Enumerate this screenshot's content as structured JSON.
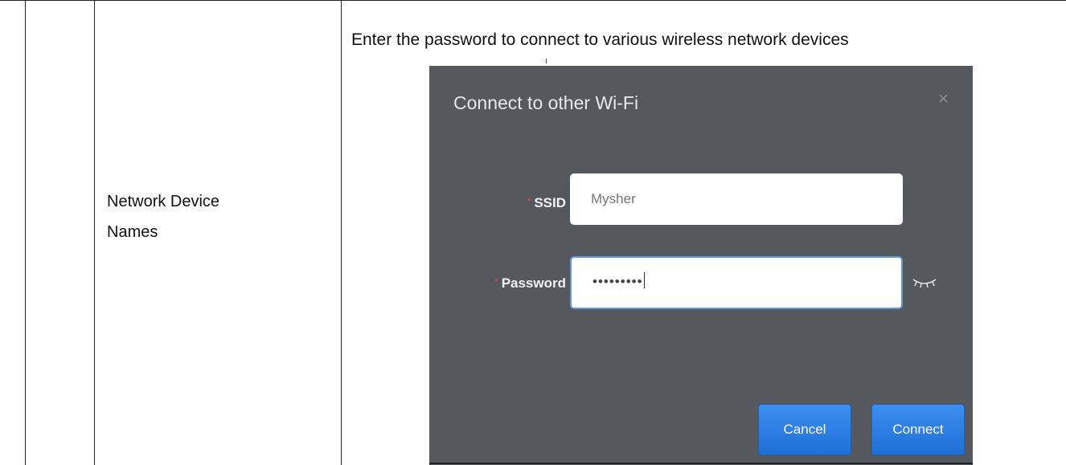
{
  "row": {
    "label_line1": "Network Device",
    "label_line2": "Names",
    "caption": "Enter the password to connect to various wireless network devices"
  },
  "dialog": {
    "title": "Connect to other Wi-Fi",
    "close_glyph": "×",
    "required_marker": "*",
    "ssid_label": "SSID",
    "ssid_value": "Mysher",
    "password_label": "Password",
    "password_value": "•••••••••",
    "cancel_label": "Cancel",
    "connect_label": "Connect",
    "icons": {
      "close": "close-icon",
      "reveal": "eye-closed-icon"
    },
    "colors": {
      "background": "#55585c",
      "button": "#2a7de4",
      "required": "#e05050",
      "focus_border": "#5c9be0"
    }
  }
}
